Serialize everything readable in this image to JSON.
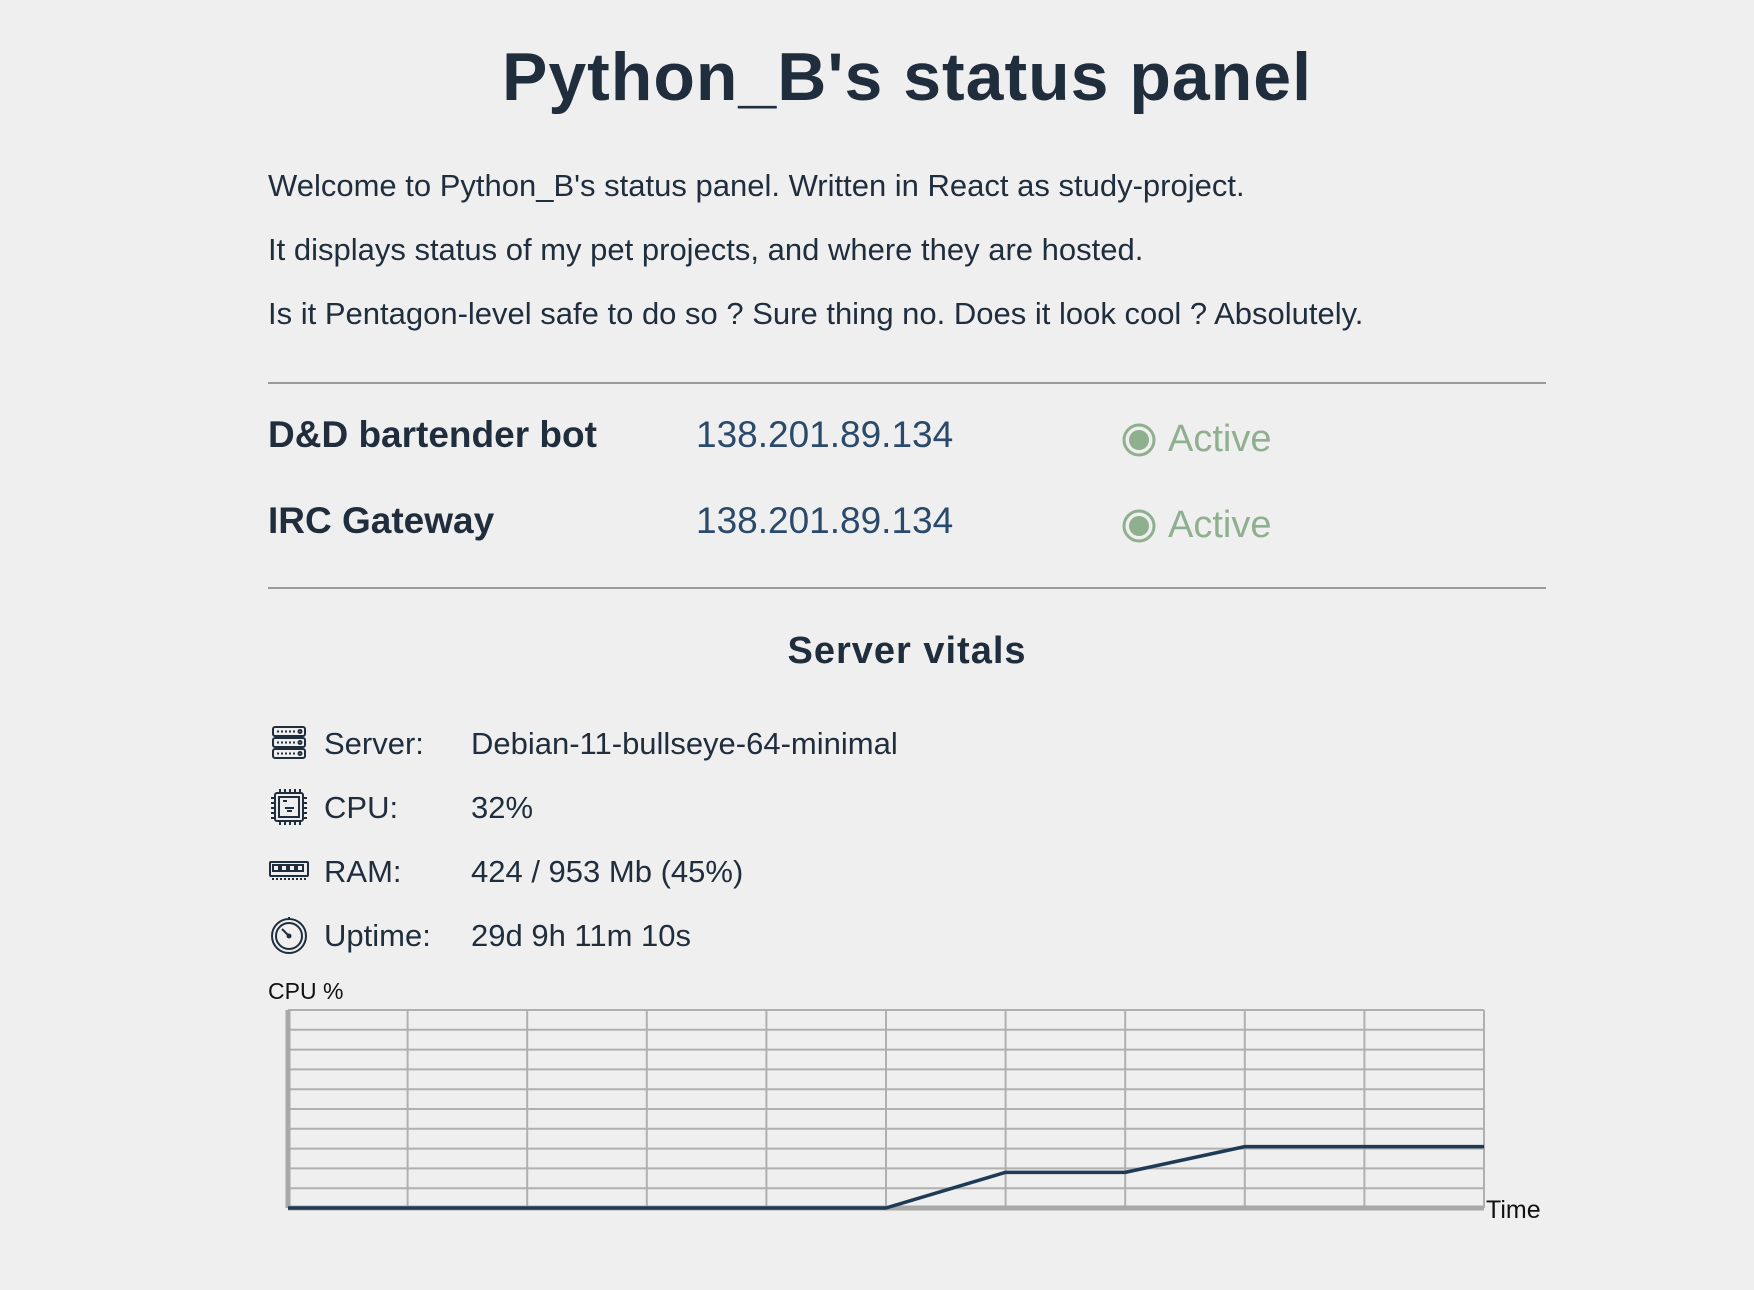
{
  "header": {
    "title": "Python_B's status panel"
  },
  "intro": {
    "p1": "Welcome to Python_B's status panel. Written in React as study-project.",
    "p2": "It displays status of my pet projects, and where they are hosted.",
    "p3": "Is it Pentagon-level safe to do so ? Sure thing no. Does it look cool ? Absolutely."
  },
  "projects": [
    {
      "name": "D&D bartender bot",
      "ip": "138.201.89.134",
      "status": "Active"
    },
    {
      "name": "IRC Gateway",
      "ip": "138.201.89.134",
      "status": "Active"
    }
  ],
  "colors": {
    "active": "#8fb08f",
    "text": "#1f2d3d",
    "line": "#1f3a55",
    "grid": "#b0b0b0",
    "background": "#efefef"
  },
  "vitals": {
    "title": "Server vitals",
    "items": [
      {
        "icon": "server-icon",
        "label": "Server:",
        "value": "Debian-11-bullseye-64-minimal"
      },
      {
        "icon": "cpu-icon",
        "label": "CPU:",
        "value": "32%"
      },
      {
        "icon": "ram-icon",
        "label": "RAM:",
        "value": "424 / 953 Mb (45%)"
      },
      {
        "icon": "stopwatch-icon",
        "label": "Uptime:",
        "value": "29d 9h 11m 10s"
      }
    ]
  },
  "chart_data": {
    "type": "line",
    "title": "",
    "ylabel": "CPU %",
    "xlabel": "Time",
    "ylim": [
      0,
      100
    ],
    "grid": true,
    "x": [
      0,
      1,
      2,
      3,
      4,
      5,
      6,
      7,
      8,
      9,
      10
    ],
    "series": [
      {
        "values": [
          0,
          0,
          0,
          0,
          0,
          0,
          18,
          18,
          31,
          31,
          31
        ]
      }
    ]
  }
}
